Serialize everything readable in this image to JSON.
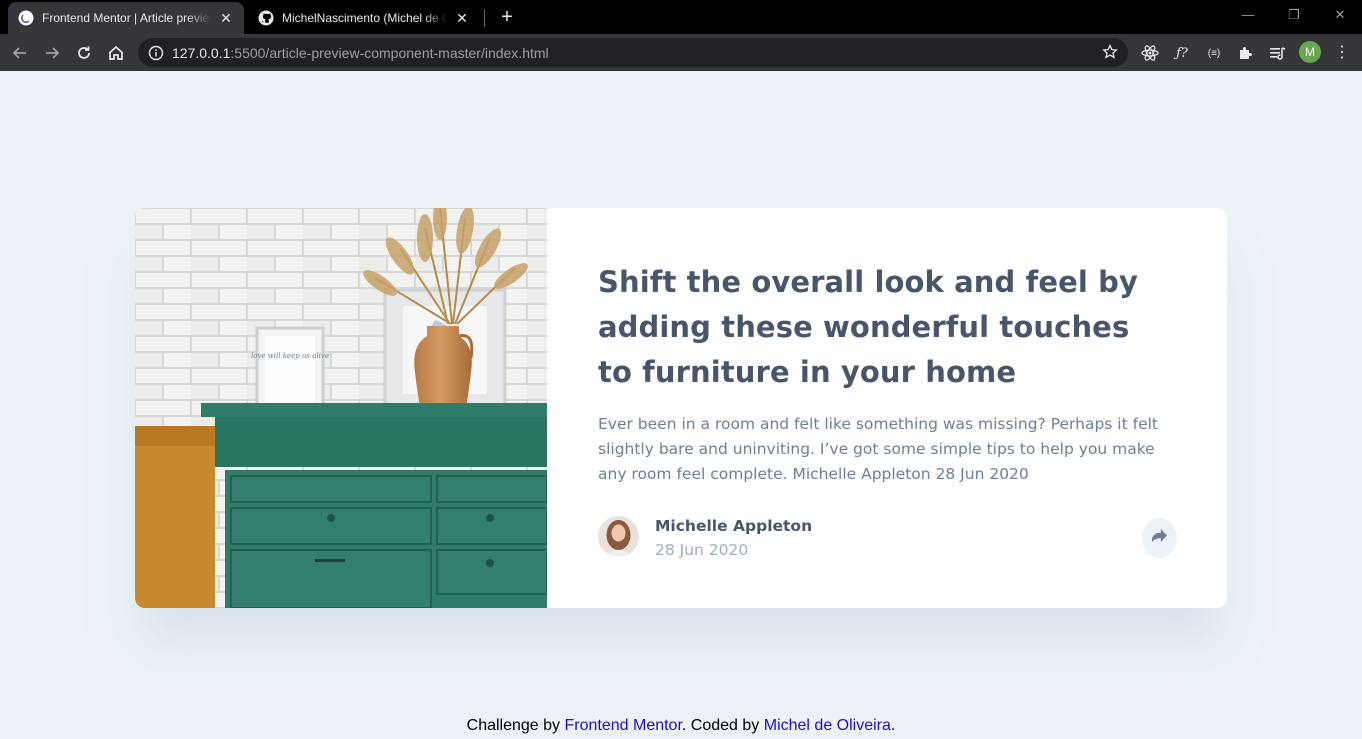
{
  "browser": {
    "tabs": [
      {
        "title": "Frontend Mentor | Article preview component",
        "active": true
      },
      {
        "title": "MichelNascimento (Michel de Oliveira)",
        "active": false
      }
    ],
    "address": {
      "host": "127.0.0.1",
      "path": ":5500/article-preview-component-master/index.html"
    },
    "profile_initial": "M",
    "extensions": [
      "react-devtools-icon",
      "font-finder-icon",
      "wappalyzer-icon",
      "puzzle-icon",
      "reading-list-icon"
    ]
  },
  "article": {
    "headline": "Shift the overall look and feel by adding these wonderful touches to furniture in your home",
    "summary": "Ever been in a room and felt like something was missing? Perhaps it felt slightly bare and uninviting. I’ve got some simple tips to help you make any room feel complete. Michelle Appleton 28 Jun 2020",
    "author": {
      "name": "Michelle Appleton",
      "date": "28 Jun 2020"
    },
    "image_frame_text": "love will keep us alive"
  },
  "footer": {
    "prefix": "Challenge by",
    "link1": "Frontend Mentor",
    "middle": ". Coded by",
    "link2": "Michel de Oliveira",
    "suffix": "."
  },
  "colors": {
    "page_background": "#ecf2f8",
    "headline": "#48556a",
    "body_text": "#6d7f97",
    "muted": "#9eafc2",
    "drawer_green": "#2e7d6a"
  }
}
